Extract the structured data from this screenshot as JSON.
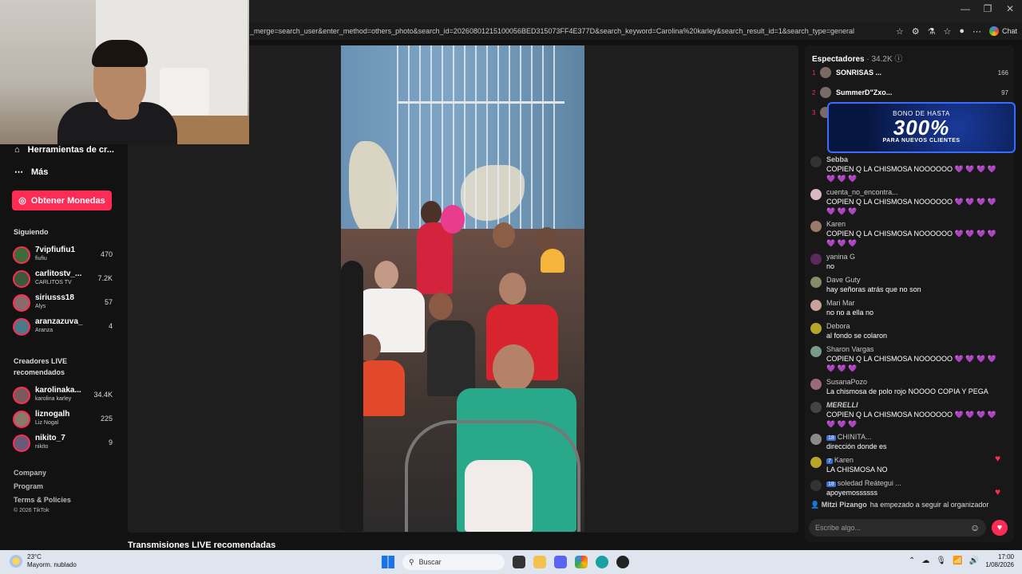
{
  "browser": {
    "url": "_merge=search_user&enter_method=others_photo&search_id=20260801215100056BED315073FF4E377D&search_keyword=Carolina%20karley&search_result_id=1&search_type=general",
    "chat_label": "Chat"
  },
  "sidebar": {
    "creator_tools": "Herramientas de cr...",
    "more": "Más",
    "coins_button": "Obtener Monedas",
    "following_title": "Siguiendo",
    "following": [
      {
        "name": "7vipfiufiu1",
        "sub": "fiufiu",
        "count": "470"
      },
      {
        "name": "carlitostv_...",
        "sub": "CARLITOS TV",
        "count": "7.2K"
      },
      {
        "name": "siriusss18",
        "sub": "Alys",
        "count": "57"
      },
      {
        "name": "aranzazuva_",
        "sub": "Aranza",
        "count": "4"
      }
    ],
    "recommended_title": "Creadores LIVE recomendados",
    "recommended": [
      {
        "name": "karolinaka...",
        "sub": "karolina karley",
        "count": "34.4K"
      },
      {
        "name": "liznogalh",
        "sub": "Liz Nogal",
        "count": "225"
      },
      {
        "name": "nikito_7",
        "sub": "nikito",
        "count": "9"
      }
    ],
    "footer": {
      "company": "Company",
      "program": "Program",
      "terms": "Terms & Policies",
      "copyright": "© 2026 TikTok"
    }
  },
  "main": {
    "recommended_live_title": "Transmisiones LIVE recomendadas"
  },
  "viewers": {
    "title": "Espectadores",
    "count": "· 34.2K",
    "ranks": [
      {
        "rank": "1",
        "name": "SONRISAS ...",
        "score": "166"
      },
      {
        "rank": "2",
        "name": "SummerD\"Zxo...",
        "score": "97"
      },
      {
        "rank": "3",
        "name": "",
        "score": ""
      }
    ]
  },
  "promo": {
    "line1": "BONO DE HASTA",
    "line2": "300%",
    "line3": "PARA NUEVOS CLIENTES"
  },
  "chat": {
    "messages": [
      {
        "user": "Sebba",
        "text": "COPIEN Q LA CHISMOSA NOOOOOO 💜 💜 💜 💜 💜 💜 💜"
      },
      {
        "user": "cuenta_no_encontra...",
        "text": "COPIEN Q LA CHISMOSA NOOOOOO 💜 💜 💜 💜 💜 💜 💜"
      },
      {
        "user": "Karen",
        "text": "COPIEN Q LA CHISMOSA NOOOOOO 💜 💜 💜 💜 💜 💜 💜"
      },
      {
        "user": "yanina G",
        "text": "no"
      },
      {
        "user": "Dave Guty",
        "text": "hay señoras atrás que no son"
      },
      {
        "user": "Mari Mar",
        "text": "no no a ella no"
      },
      {
        "user": "Debora",
        "text": "al fondo se colaron"
      },
      {
        "user": "Sharon Vargas",
        "text": "COPIEN Q LA CHISMOSA NOOOOOO 💜 💜 💜 💜 💜 💜 💜"
      },
      {
        "user": "SusanaPozo",
        "text": "La chismosa de polo rojo NOOOO COPIA Y PEGA"
      },
      {
        "user": "MERELLI",
        "text": "COPIEN Q LA CHISMOSA NOOOOOO 💜 💜 💜 💜 💜 💜 💜"
      },
      {
        "user": "CHINITA...",
        "badge": "18",
        "text": "dirección donde es"
      },
      {
        "user": "Karen",
        "badge": "7",
        "text": "LA CHISMOSA NO"
      },
      {
        "user": "soledad Reátegui ...",
        "badge": "18",
        "text": "apoyemossssss"
      }
    ],
    "join_user": "Mitzi Pizango",
    "join_text": "ha empezado a seguir al organizador",
    "input_placeholder": "Escribe algo..."
  },
  "taskbar": {
    "temp": "23°C",
    "weather": "Mayorm. nublado",
    "search": "Buscar",
    "time": "17:00",
    "date": "1/08/2026"
  }
}
